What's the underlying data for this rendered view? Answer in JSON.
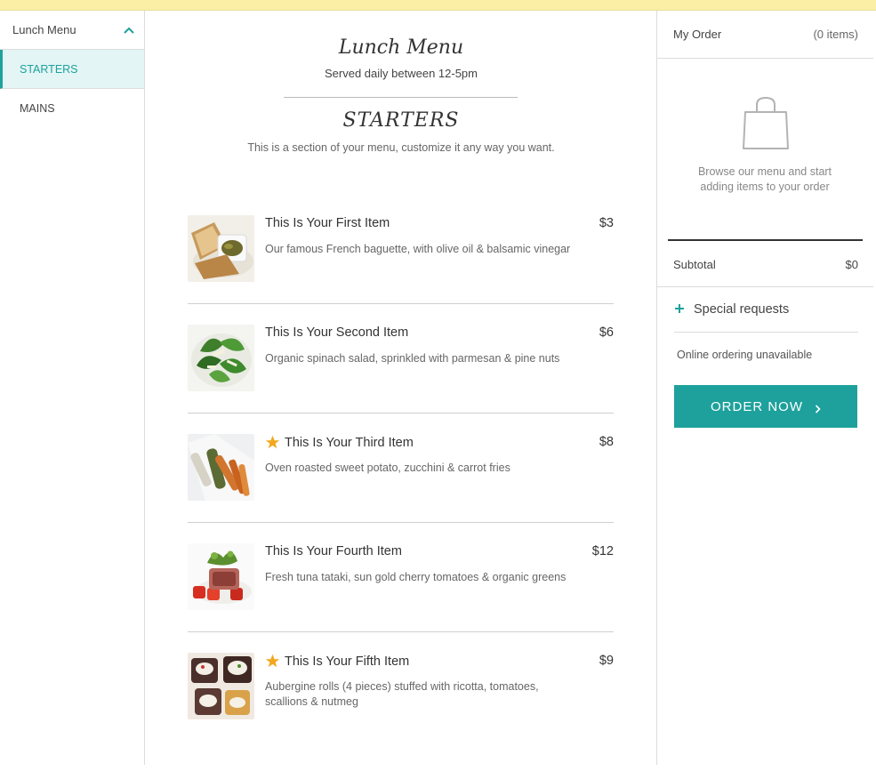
{
  "sidebar": {
    "menu_select": "Lunch Menu",
    "categories": [
      {
        "label": "STARTERS",
        "active": true
      },
      {
        "label": "MAINS",
        "active": false
      }
    ]
  },
  "main": {
    "menu_title": "Lunch Menu",
    "menu_subtitle": "Served daily between 12-5pm",
    "section_title": "STARTERS",
    "section_desc": "This is a section of your menu, customize it any way you want.",
    "items": [
      {
        "name": "This Is Your First Item",
        "price": "$3",
        "desc": "Our famous French baguette, with olive oil & balsamic vinegar",
        "featured": false
      },
      {
        "name": "This Is Your Second Item",
        "price": "$6",
        "desc": "Organic spinach salad, sprinkled with parmesan & pine nuts",
        "featured": false
      },
      {
        "name": "This Is Your Third Item",
        "price": "$8",
        "desc": "Oven roasted sweet potato, zucchini & carrot fries",
        "featured": true
      },
      {
        "name": "This Is Your Fourth Item",
        "price": "$12",
        "desc": "Fresh tuna tataki, sun gold cherry tomatoes & organic greens",
        "featured": false
      },
      {
        "name": "This Is Your Fifth Item",
        "price": "$9",
        "desc": "Aubergine rolls (4 pieces) stuffed with ricotta, tomatoes, scallions & nutmeg",
        "featured": true
      }
    ]
  },
  "order": {
    "title": "My Order",
    "count": "(0 items)",
    "empty_message": "Browse our menu and start adding items to your order",
    "subtotal_label": "Subtotal",
    "subtotal_value": "$0",
    "special_requests": "Special requests",
    "status": "Online ordering unavailable",
    "order_button": "ORDER NOW"
  },
  "colors": {
    "accent": "#1ea19c",
    "top_banner": "#fbeea5",
    "star": "#f2a81d"
  },
  "icons": {
    "menu_select": "chevron-up-icon",
    "bag": "shopping-bag-icon",
    "featured": "star-icon",
    "special_requests": "plus-icon",
    "order_button": "chevron-right-icon"
  }
}
